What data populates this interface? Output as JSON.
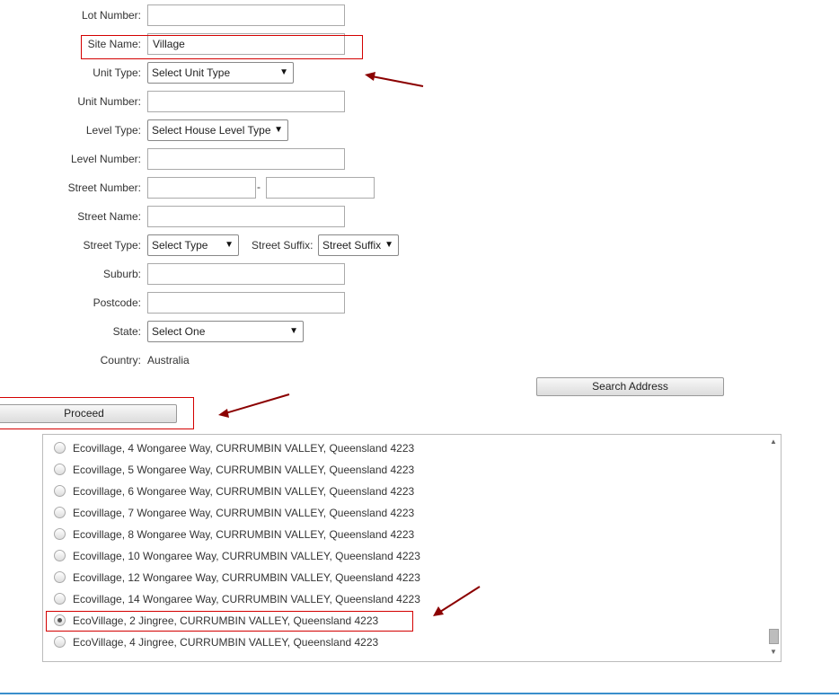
{
  "form": {
    "lot_number": {
      "label": "Lot Number:",
      "value": ""
    },
    "site_name": {
      "label": "Site Name:",
      "value": "Village"
    },
    "unit_type": {
      "label": "Unit Type:",
      "selected": "Select Unit Type"
    },
    "unit_number": {
      "label": "Unit Number:",
      "value": ""
    },
    "level_type": {
      "label": "Level Type:",
      "selected": "Select House Level Type"
    },
    "level_number": {
      "label": "Level Number:",
      "value": ""
    },
    "street_number": {
      "label": "Street Number:",
      "from": "",
      "separator": "-",
      "to": ""
    },
    "street_name": {
      "label": "Street Name:",
      "value": ""
    },
    "street_type": {
      "label": "Street Type:",
      "selected": "Select Type"
    },
    "street_suffix": {
      "label": "Street Suffix:",
      "selected": "Street Suffix"
    },
    "suburb": {
      "label": "Suburb:",
      "value": ""
    },
    "postcode": {
      "label": "Postcode:",
      "value": ""
    },
    "state": {
      "label": "State:",
      "selected": "Select One"
    },
    "country": {
      "label": "Country:",
      "value": "Australia"
    }
  },
  "buttons": {
    "search_address": "Search Address",
    "proceed": "Proceed"
  },
  "address_results": [
    {
      "text": "Ecovillage, 4 Wongaree Way, CURRUMBIN VALLEY, Queensland 4223",
      "selected": false
    },
    {
      "text": "Ecovillage, 5 Wongaree Way, CURRUMBIN VALLEY, Queensland 4223",
      "selected": false
    },
    {
      "text": "Ecovillage, 6 Wongaree Way, CURRUMBIN VALLEY, Queensland 4223",
      "selected": false
    },
    {
      "text": "Ecovillage, 7 Wongaree Way, CURRUMBIN VALLEY, Queensland 4223",
      "selected": false
    },
    {
      "text": "Ecovillage, 8 Wongaree Way, CURRUMBIN VALLEY, Queensland 4223",
      "selected": false
    },
    {
      "text": "Ecovillage, 10 Wongaree Way, CURRUMBIN VALLEY, Queensland 4223",
      "selected": false
    },
    {
      "text": "Ecovillage, 12 Wongaree Way, CURRUMBIN VALLEY, Queensland 4223",
      "selected": false
    },
    {
      "text": "Ecovillage, 14 Wongaree Way, CURRUMBIN VALLEY, Queensland 4223",
      "selected": false
    },
    {
      "text": "EcoVillage, 2 Jingree, CURRUMBIN VALLEY, Queensland 4223",
      "selected": true
    },
    {
      "text": "EcoVillage, 4 Jingree, CURRUMBIN VALLEY, Queensland 4223",
      "selected": false
    }
  ],
  "icons": {
    "dropdown": "triangle-down-icon",
    "scroll_up": "triangle-up-icon",
    "scroll_down": "triangle-down-icon"
  },
  "colors": {
    "highlight": "#d40000",
    "arrow": "#8b0000",
    "accent_line": "#3a8fcc"
  }
}
